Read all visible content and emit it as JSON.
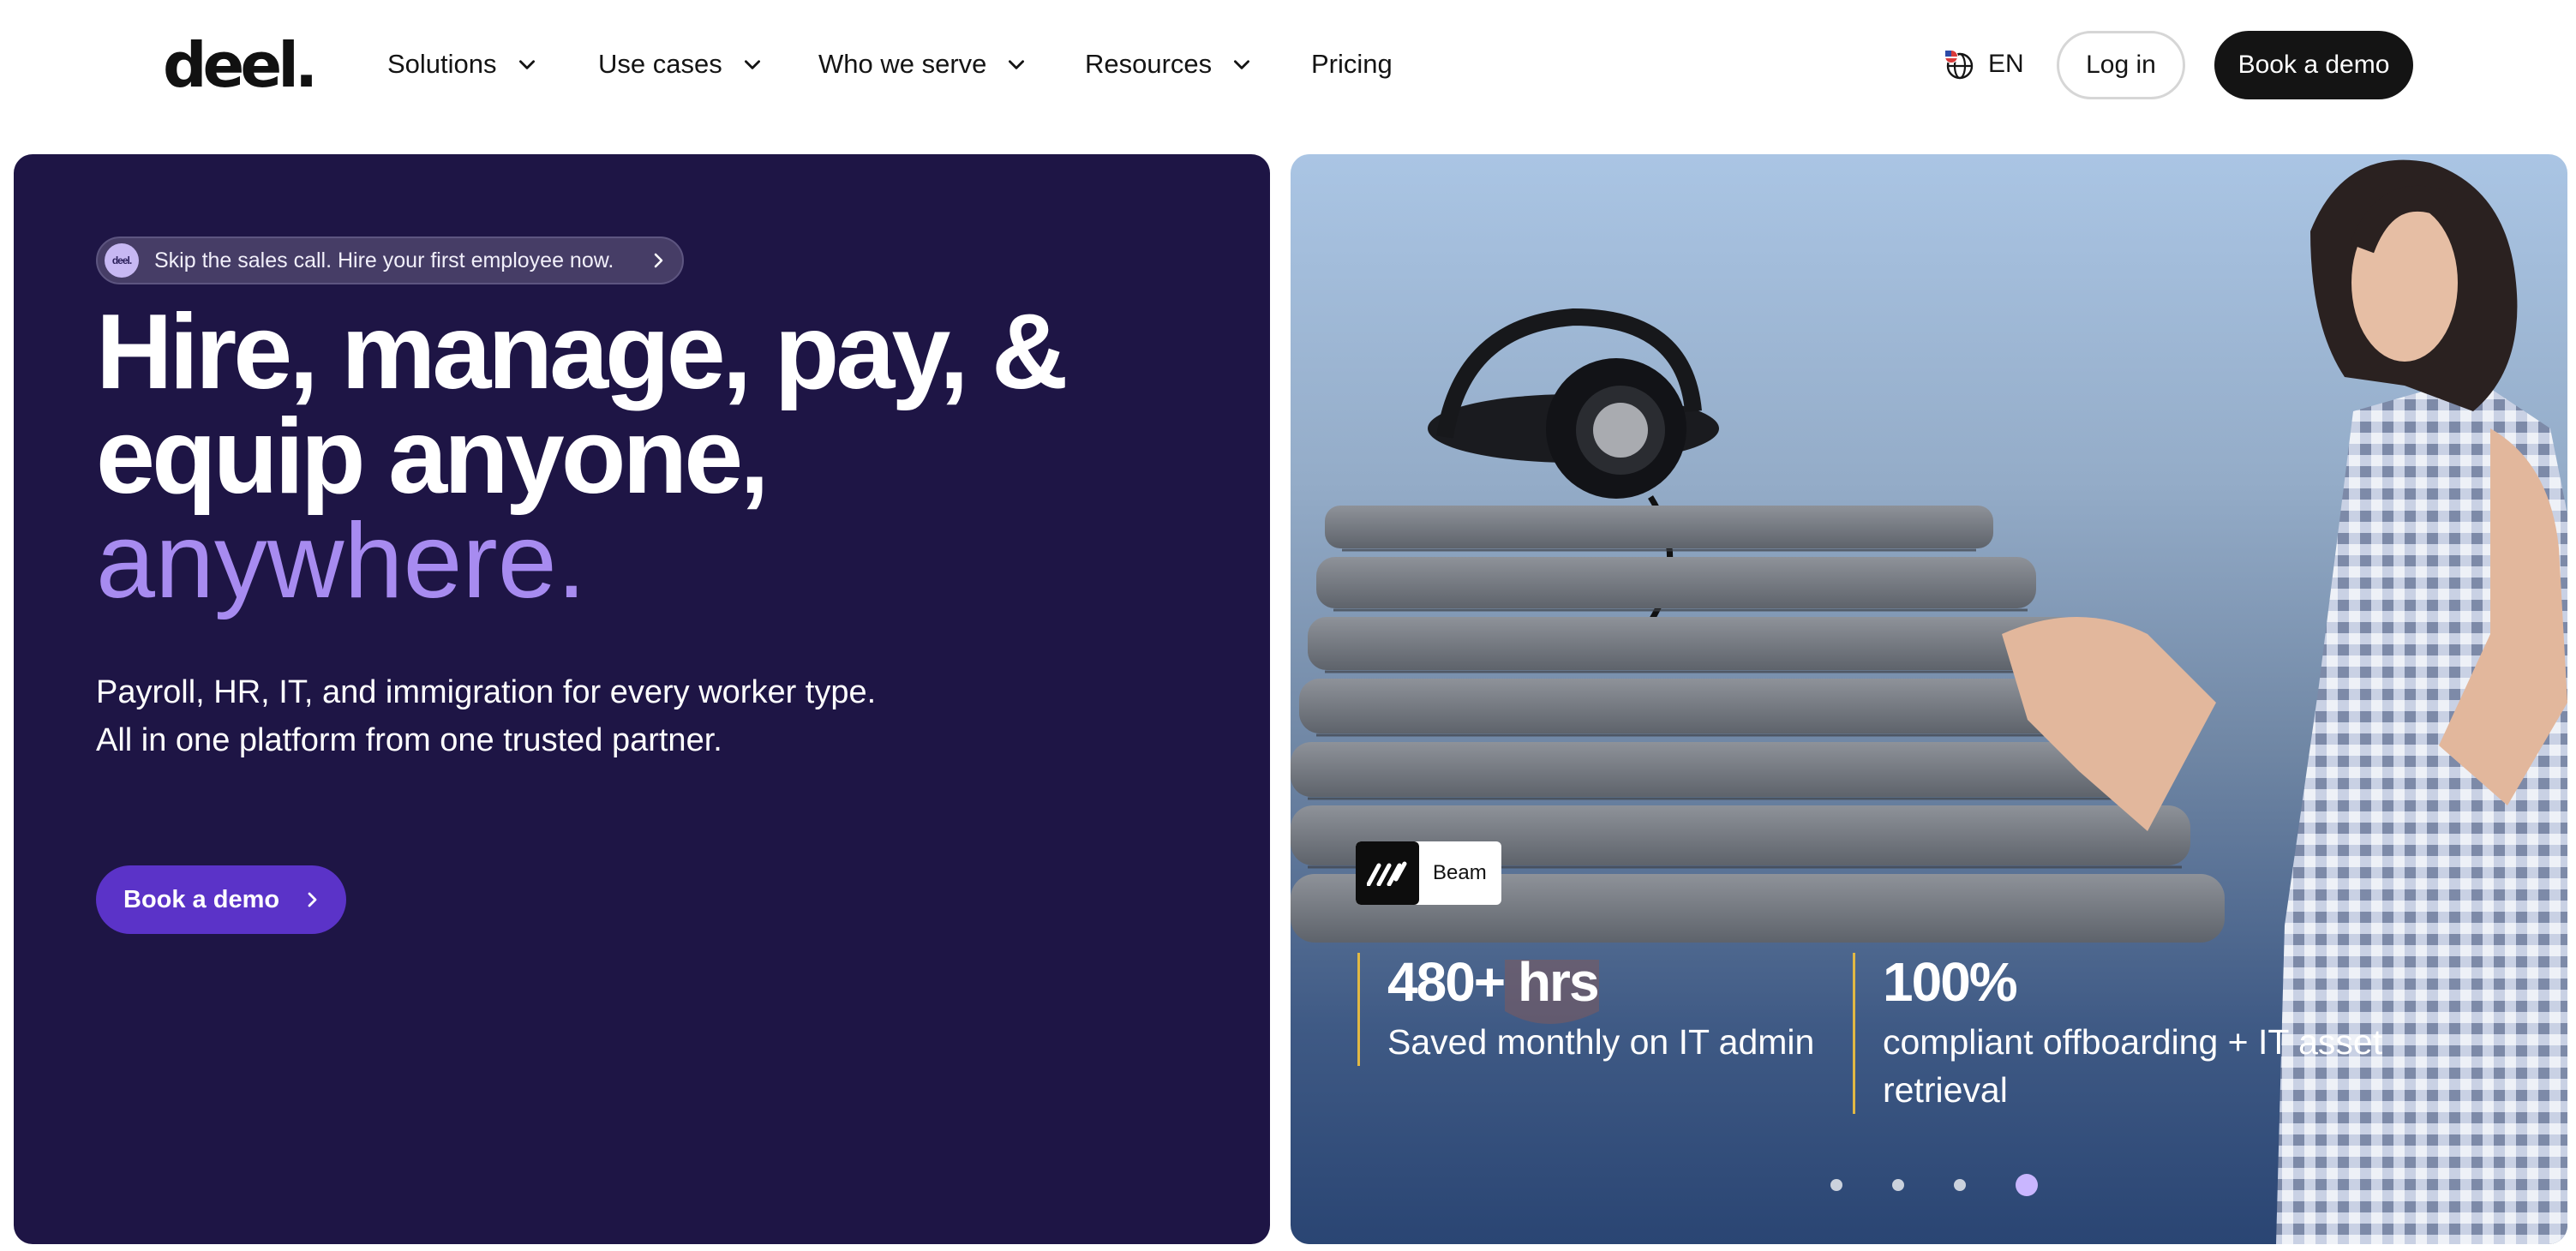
{
  "nav": {
    "logo": "deel.",
    "items": [
      {
        "label": "Solutions",
        "has_dropdown": true
      },
      {
        "label": "Use cases",
        "has_dropdown": true
      },
      {
        "label": "Who we serve",
        "has_dropdown": true
      },
      {
        "label": "Resources",
        "has_dropdown": true
      },
      {
        "label": "Pricing",
        "has_dropdown": false
      }
    ],
    "language": "EN",
    "login_label": "Log in",
    "demo_label": "Book a demo"
  },
  "hero": {
    "promo": {
      "badge": "deel.",
      "text": "Skip the sales call. Hire your first employee now."
    },
    "headline_line1": "Hire, manage, pay, &",
    "headline_line2": "equip anyone,",
    "headline_accent": "anywhere.",
    "subtitle_line1": "Payroll, HR, IT, and immigration for every worker type.",
    "subtitle_line2": "All in one platform from one trusted partner.",
    "cta_label": "Book a demo"
  },
  "showcase": {
    "company": "Beam",
    "stats": [
      {
        "value": "480+ hrs",
        "label": "Saved monthly on IT admin"
      },
      {
        "value": "100%",
        "label": "compliant offboarding + IT asset retrieval"
      }
    ],
    "carousel": {
      "count": 4,
      "active_index": 3
    }
  },
  "colors": {
    "hero_bg": "#1e1545",
    "accent_purple": "#a78bf0",
    "cta_purple": "#5b33c8",
    "stat_divider": "#e1b844",
    "dark": "#141414"
  }
}
